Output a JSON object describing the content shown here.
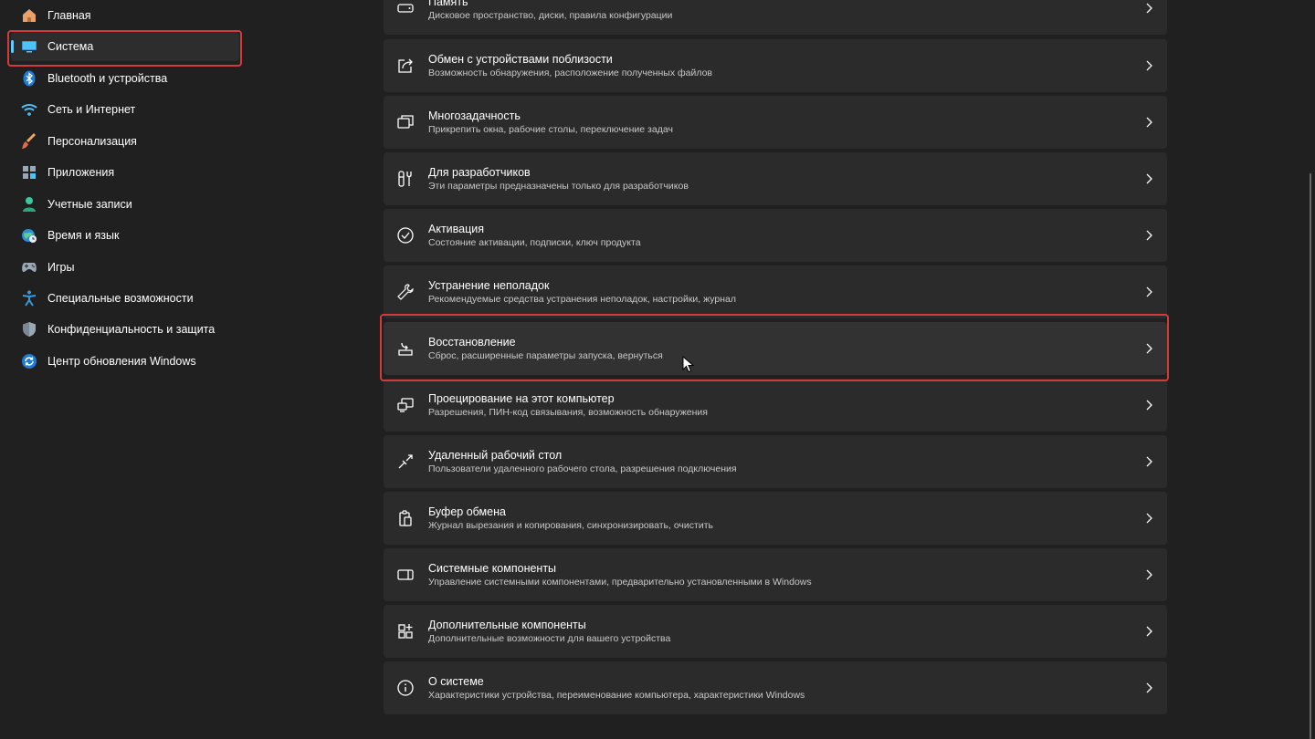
{
  "sidebar": {
    "items": [
      {
        "label": "Главная",
        "icon": "home-icon"
      },
      {
        "label": "Система",
        "icon": "system-display-icon",
        "selected": true
      },
      {
        "label": "Bluetooth и устройства",
        "icon": "bluetooth-icon"
      },
      {
        "label": "Сеть и Интернет",
        "icon": "wifi-icon"
      },
      {
        "label": "Персонализация",
        "icon": "brush-icon"
      },
      {
        "label": "Приложения",
        "icon": "apps-icon"
      },
      {
        "label": "Учетные записи",
        "icon": "account-icon"
      },
      {
        "label": "Время и язык",
        "icon": "globe-clock-icon"
      },
      {
        "label": "Игры",
        "icon": "gamepad-icon"
      },
      {
        "label": "Специальные возможности",
        "icon": "accessibility-icon"
      },
      {
        "label": "Конфиденциальность и защита",
        "icon": "shield-icon"
      },
      {
        "label": "Центр обновления Windows",
        "icon": "windows-update-icon"
      }
    ]
  },
  "main": {
    "items": [
      {
        "title": "Память",
        "subtitle": "Дисковое пространство, диски, правила конфигурации",
        "icon": "storage-drive-icon"
      },
      {
        "title": "Обмен с устройствами поблизости",
        "subtitle": "Возможность обнаружения, расположение полученных файлов",
        "icon": "share-icon"
      },
      {
        "title": "Многозадачность",
        "subtitle": "Прикрепить окна, рабочие столы, переключение задач",
        "icon": "multitasking-icon"
      },
      {
        "title": "Для разработчиков",
        "subtitle": "Эти параметры предназначены только для разработчиков",
        "icon": "developer-tools-icon"
      },
      {
        "title": "Активация",
        "subtitle": "Состояние активации, подписки, ключ продукта",
        "icon": "check-circle-icon"
      },
      {
        "title": "Устранение неполадок",
        "subtitle": "Рекомендуемые средства устранения неполадок, настройки, журнал",
        "icon": "wrench-icon"
      },
      {
        "title": "Восстановление",
        "subtitle": "Сброс, расширенные параметры запуска, вернуться",
        "icon": "recovery-icon",
        "hovered": true
      },
      {
        "title": "Проецирование на этот компьютер",
        "subtitle": "Разрешения, ПИН-код связывания, возможность обнаружения",
        "icon": "projection-icon"
      },
      {
        "title": "Удаленный рабочий стол",
        "subtitle": "Пользователи удаленного рабочего стола, разрешения подключения",
        "icon": "remote-desktop-icon"
      },
      {
        "title": "Буфер обмена",
        "subtitle": "Журнал вырезания и копирования, синхронизировать, очистить",
        "icon": "clipboard-icon"
      },
      {
        "title": "Системные компоненты",
        "subtitle": "Управление системными компонентами, предварительно установленными в Windows",
        "icon": "system-components-icon"
      },
      {
        "title": "Дополнительные компоненты",
        "subtitle": "Дополнительные возможности для вашего устройства",
        "icon": "optional-features-icon"
      },
      {
        "title": "О системе",
        "subtitle": "Характеристики устройства, переименование компьютера, характеристики Windows",
        "icon": "info-icon"
      }
    ]
  },
  "colors": {
    "background": "#202020",
    "card": "#2b2b2b",
    "accent": "#60cdff",
    "highlight": "#d23b3b"
  }
}
